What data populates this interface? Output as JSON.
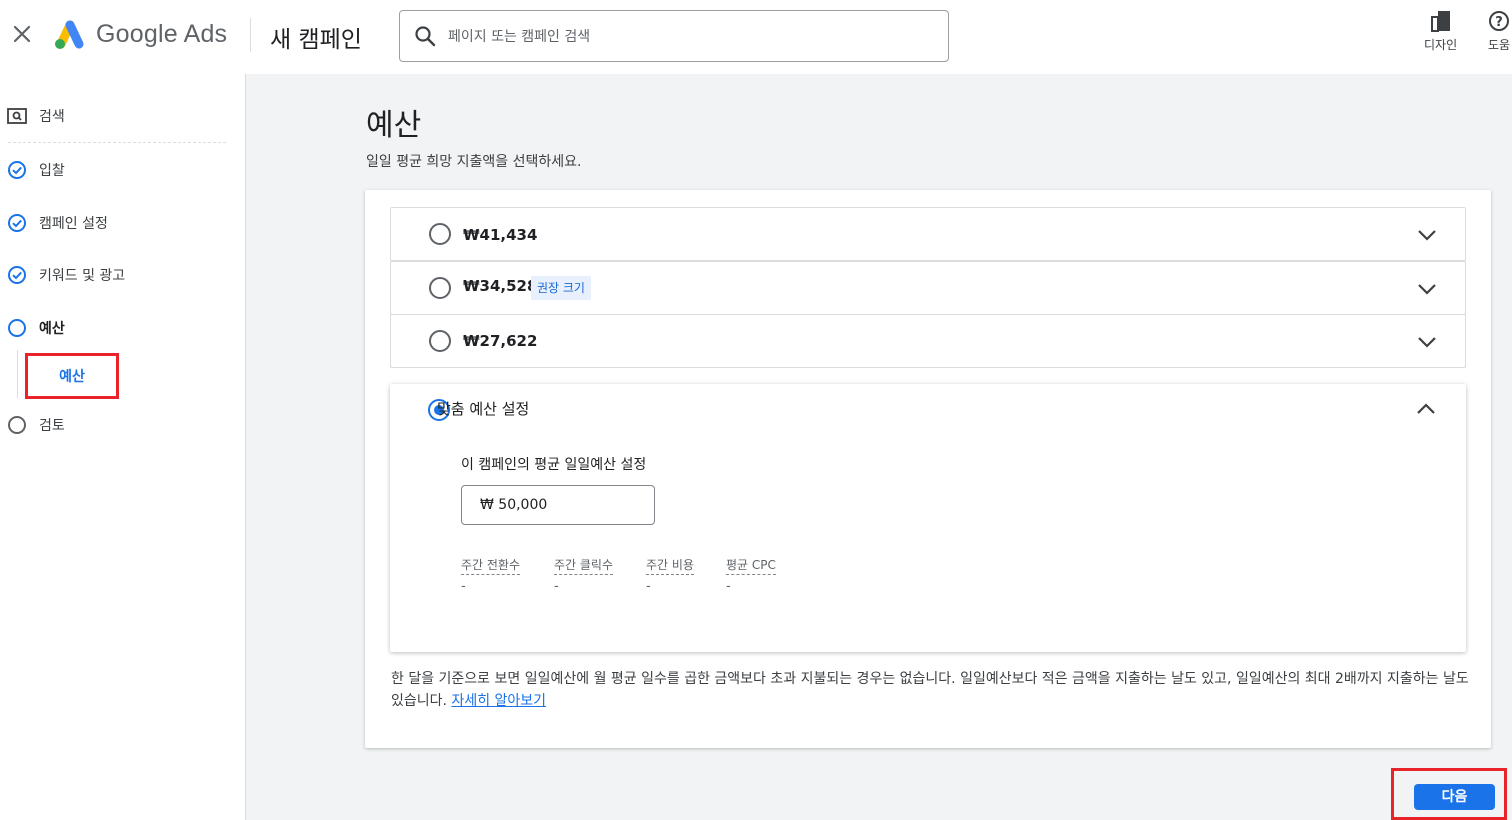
{
  "header": {
    "app_name": "Google Ads",
    "campaign_title": "새 캠페인",
    "search_placeholder": "페이지 또는 캠페인 검색",
    "tools": [
      {
        "label": "디자인",
        "icon": "design-icon"
      },
      {
        "label": "도움",
        "icon": "help-icon"
      }
    ]
  },
  "sidebar": {
    "items": [
      {
        "label": "검색",
        "icon": "search-campaign-icon",
        "state": "type"
      },
      {
        "label": "입찰",
        "icon": "check-circle-icon",
        "state": "done"
      },
      {
        "label": "캠페인 설정",
        "icon": "check-circle-icon",
        "state": "done"
      },
      {
        "label": "키워드 및 광고",
        "icon": "check-circle-icon",
        "state": "done"
      },
      {
        "label": "예산",
        "icon": "empty-circle-icon",
        "state": "active"
      },
      {
        "label": "검토",
        "icon": "empty-circle-icon",
        "state": "pending"
      }
    ],
    "sub_item": "예산"
  },
  "main": {
    "title": "예산",
    "subtitle": "일일 평균 희망 지출액을 선택하세요.",
    "options": [
      {
        "amount": "₩41,434",
        "selected": false
      },
      {
        "amount": "₩34,528",
        "badge": "권장 크기",
        "selected": false
      },
      {
        "amount": "₩27,622",
        "selected": false
      }
    ],
    "custom": {
      "label": "맞춤 예산 설정",
      "selected": true,
      "field_label": "이 캠페인의 평균 일일예산 설정",
      "input_value": "₩ 50,000",
      "metrics": [
        {
          "label": "주간 전환수",
          "value": "-"
        },
        {
          "label": "주간 클릭수",
          "value": "-"
        },
        {
          "label": "주간 비용",
          "value": "-"
        },
        {
          "label": "평균 CPC",
          "value": "-"
        }
      ]
    },
    "info_text": "한 달을 기준으로 보면 일일예산에 월 평균 일수를 곱한 금액보다 초과 지불되는 경우는 없습니다. 일일예산보다 적은 금액을 지출하는 날도 있고, 일일예산의 최대 2배까지 지출하는 날도 있습니다.",
    "info_link": "자세히 알아보기"
  },
  "footer": {
    "next_label": "다음"
  },
  "colors": {
    "accent": "#1a73e8",
    "highlight_frame": "#e8232a",
    "background": "#f1f3f4"
  }
}
